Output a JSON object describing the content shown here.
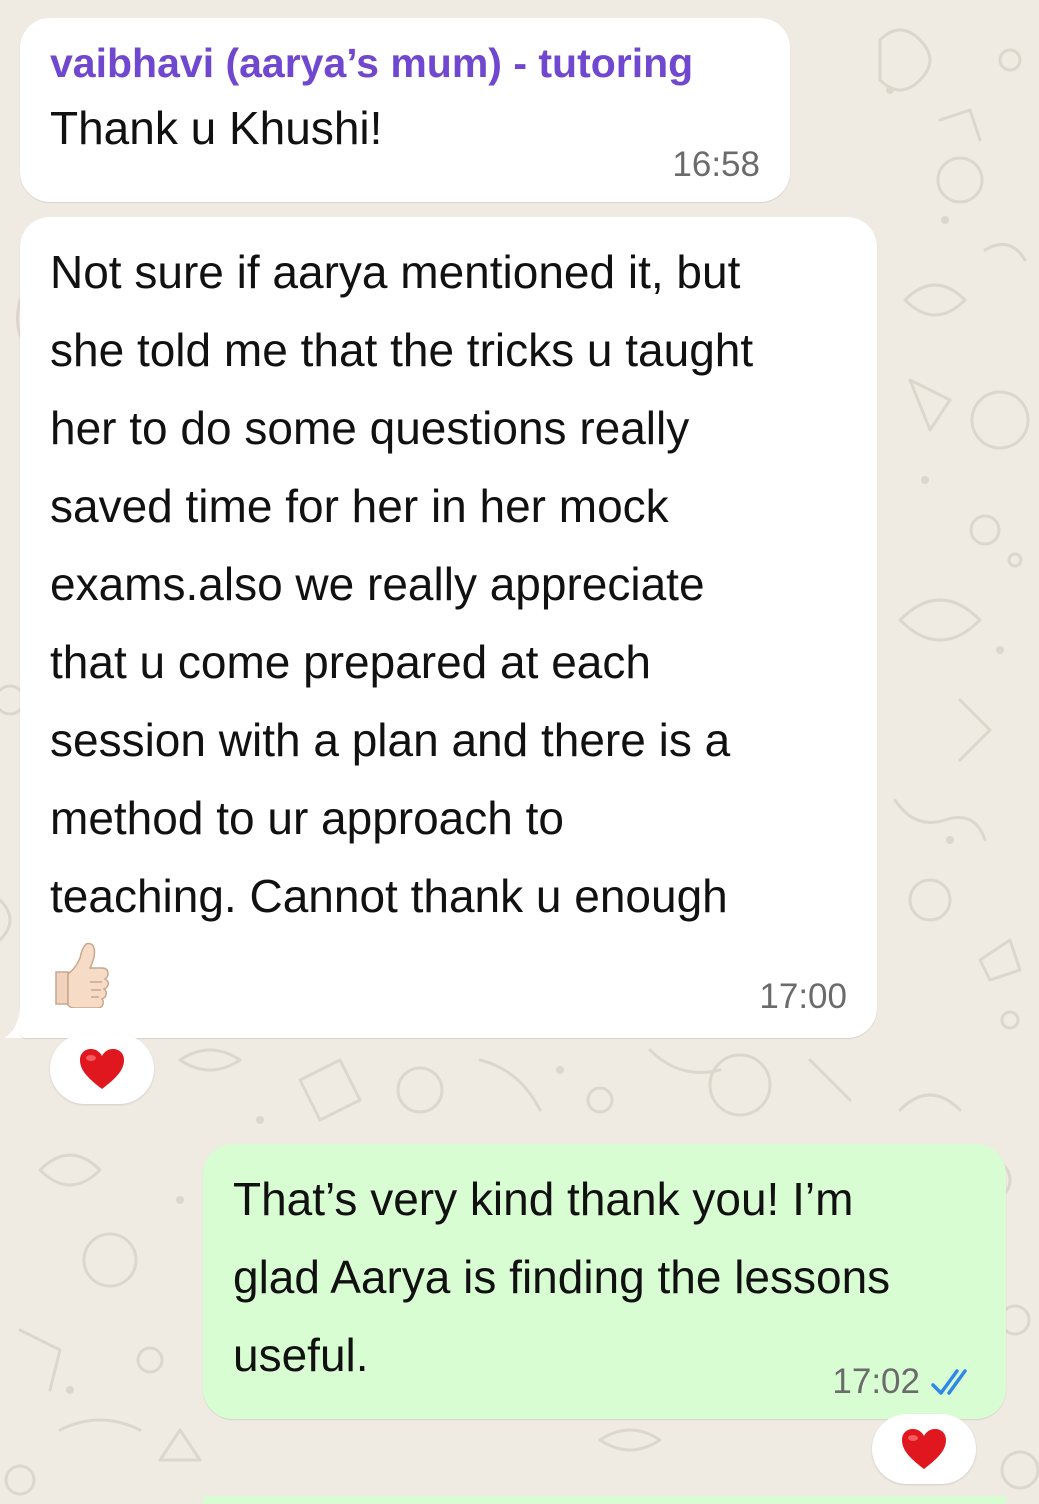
{
  "conversation": {
    "messages": [
      {
        "direction": "incoming",
        "sender": "vaibhavi (aarya’s mum) - tutoring",
        "text": "Thank u Khushi!",
        "time": "16:58"
      },
      {
        "direction": "incoming",
        "text": "Not sure if aarya mentioned it, but\nshe told me that the tricks u taught\nher to do some questions really\nsaved time for her in her mock\nexams.also we really appreciate\nthat u come prepared at each\nsession with a plan and there is a\nmethod to ur approach to\nteaching. Cannot thank u enough",
        "emoji": "thumbs-up",
        "time": "17:00",
        "reaction": "red-heart"
      },
      {
        "direction": "outgoing",
        "text": "That’s very kind thank you! I’m\nglad Aarya is finding the lessons\nuseful.",
        "time": "17:02",
        "status": "read",
        "reaction": "red-heart"
      }
    ]
  },
  "colors": {
    "wallpaper": "#efeae2",
    "incoming_bubble": "#ffffff",
    "outgoing_bubble": "#d9fdd3",
    "sender_name": "#7048d0",
    "timestamp": "#6b6b6b",
    "read_receipt": "#2f88e8",
    "heart": "#e0171f"
  },
  "icons": {
    "thumbs_up": "thumbs-up-emoji",
    "reaction": "red-heart-emoji",
    "read_status": "double-check-icon"
  }
}
